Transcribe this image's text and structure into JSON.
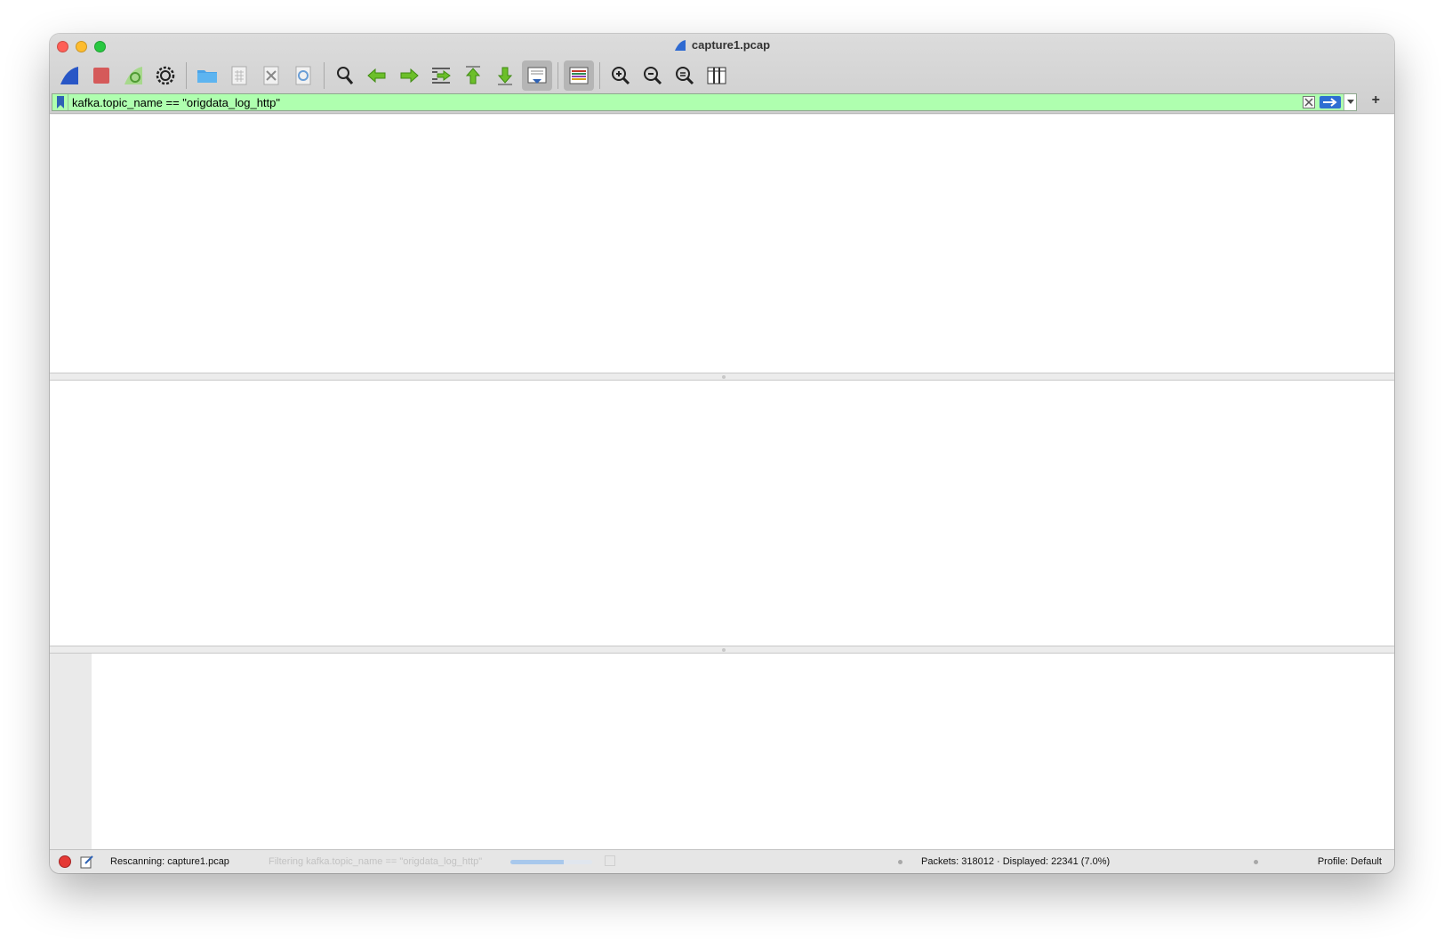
{
  "window": {
    "title": "capture1.pcap"
  },
  "toolbar": {
    "buttons": [
      {
        "name": "start-capture"
      },
      {
        "name": "stop-capture"
      },
      {
        "name": "restart-capture"
      },
      {
        "name": "capture-options"
      },
      {
        "name": "open-file"
      },
      {
        "name": "save-file"
      },
      {
        "name": "close-file"
      },
      {
        "name": "reload-file"
      },
      {
        "name": "find-packet"
      },
      {
        "name": "go-back"
      },
      {
        "name": "go-forward"
      },
      {
        "name": "go-to-packet"
      },
      {
        "name": "first-packet"
      },
      {
        "name": "last-packet"
      },
      {
        "name": "auto-scroll"
      },
      {
        "name": "colorize"
      },
      {
        "name": "zoom-in"
      },
      {
        "name": "zoom-out"
      },
      {
        "name": "normal-size"
      },
      {
        "name": "resize-columns"
      }
    ]
  },
  "filter": {
    "value": "kafka.topic_name == \"origdata_log_http\"",
    "valid_color": "#afffaf"
  },
  "status": {
    "left": "Rescanning: capture1.pcap",
    "filtering": "Filtering kafka.topic_name == \"origdata_log_http\"",
    "progress": 0.65,
    "packets": "Packets: 318012 · Displayed: 22341 (7.0%)",
    "profile": "Profile: Default"
  }
}
